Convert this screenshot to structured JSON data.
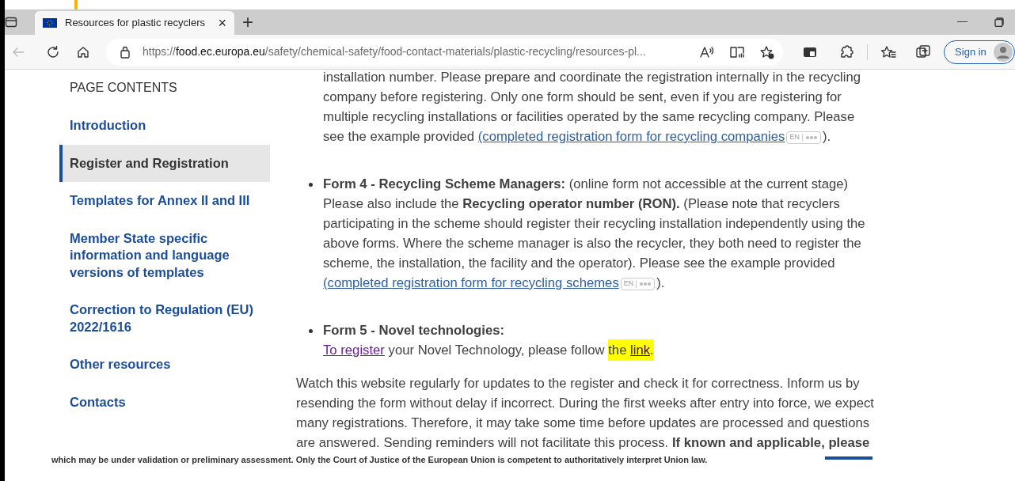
{
  "browser": {
    "tab_title": "Resources for plastic recyclers",
    "tab_close": "×",
    "new_tab": "+",
    "minimize": "—",
    "url_scheme": "https://",
    "url_host": "food.ec.europa.eu",
    "url_path": "/safety/chemical-safety/food-contact-materials/plastic-recycling/resources-pl...",
    "sign_in": "Sign in"
  },
  "sidebar": {
    "heading": "PAGE CONTENTS",
    "items": [
      {
        "label": "Introduction",
        "selected": false
      },
      {
        "label": "Register and Registration",
        "selected": true
      },
      {
        "label": "Templates for Annex II and III",
        "selected": false
      },
      {
        "label": "Member State specific information and language versions of templates",
        "selected": false
      },
      {
        "label": "Correction to Regulation (EU) 2022/1616",
        "selected": false
      },
      {
        "label": "Other resources",
        "selected": false
      },
      {
        "label": "Contacts",
        "selected": false
      }
    ]
  },
  "content": [
    {
      "kind": "continuation",
      "segments": [
        {
          "kind": "text",
          "text": "installation number. Please prepare and coordinate the registration internally in the recycling company before registering. Only one form should be sent, even if you are registering for multiple recycling installations or facilities operated by the same recycling company. Please see the example provided "
        },
        {
          "kind": "link",
          "text": "(completed registration form for recycling companies",
          "visited": false,
          "highlighted": false
        },
        {
          "kind": "badge",
          "text": "EN"
        },
        {
          "kind": "text",
          "text": ")."
        }
      ]
    },
    {
      "kind": "bullet",
      "segments": [
        {
          "kind": "text",
          "text": "**Form 4 - Recycling Scheme Managers:** (online form not accessible at the current stage) Please also include the **Recycling operator number (RON).** (Please note that recyclers participating in the scheme should register their recycling installation independently using the above forms. Where the scheme manager is also the recycler, they both need to register the scheme, the installation, the facility and the operator). Please see the example provided "
        },
        {
          "kind": "link",
          "text": "(completed registration form for recycling schemes",
          "visited": false,
          "highlighted": false
        },
        {
          "kind": "badge",
          "text": "EN"
        },
        {
          "kind": "text",
          "text": ")."
        }
      ]
    },
    {
      "kind": "bullet",
      "segments": [
        {
          "kind": "text",
          "text": "**Form 5 - Novel technologies:**"
        },
        {
          "kind": "break"
        },
        {
          "kind": "link",
          "text": "To register",
          "visited": true,
          "highlighted": false
        },
        {
          "kind": "text",
          "text": " your Novel Technology, please follow "
        },
        {
          "kind": "text",
          "text": "the ",
          "highlighted": true
        },
        {
          "kind": "link",
          "text": "link",
          "visited": true,
          "highlighted": true
        },
        {
          "kind": "text",
          "text": ".",
          "highlighted": true
        }
      ]
    },
    {
      "kind": "paragraph",
      "segments": [
        {
          "kind": "text",
          "text": "Watch this website regularly for updates to the register and check it for correctness. Inform us by resending the form without delay if incorrect. During the first weeks after entry into force, we expect many registrations. Therefore, it may take some time before updates are processed and questions are answered. Sending reminders will not facilitate this process. **If known and applicable, please**"
        }
      ]
    }
  ],
  "footer_note": "which may be under validation or preliminary assessment. Only the Court of Justice of the European Union is competent to authoritatively interpret Union law."
}
